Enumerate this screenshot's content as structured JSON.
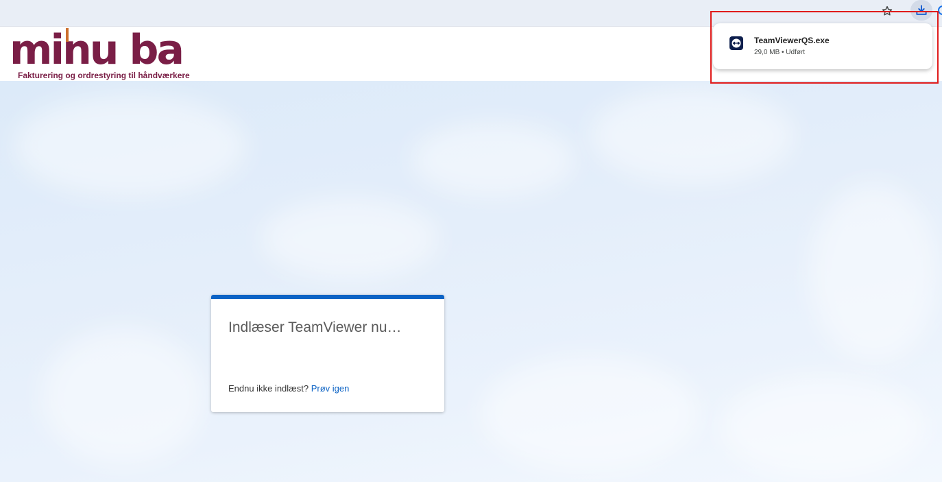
{
  "browser": {
    "icons": [
      "star-icon",
      "download-icon"
    ]
  },
  "logo": {
    "text": "minu·ba",
    "tagline": "Fakturering og ordrestyring til håndværkere",
    "colors": {
      "primary": "#7a1e46",
      "accent": "#cc6f2e"
    }
  },
  "card": {
    "title": "Indlæser TeamViewer nu…",
    "footer_text": "Endnu ikke indlæst?",
    "retry_label": "Prøv igen",
    "accent_color": "#0c63c5"
  },
  "downloads": {
    "items": [
      {
        "name": "TeamViewerQS.exe",
        "status": "29,0 MB • Udført",
        "icon": "teamviewer-icon"
      }
    ]
  },
  "annotation": {
    "color": "#e01b1b"
  }
}
